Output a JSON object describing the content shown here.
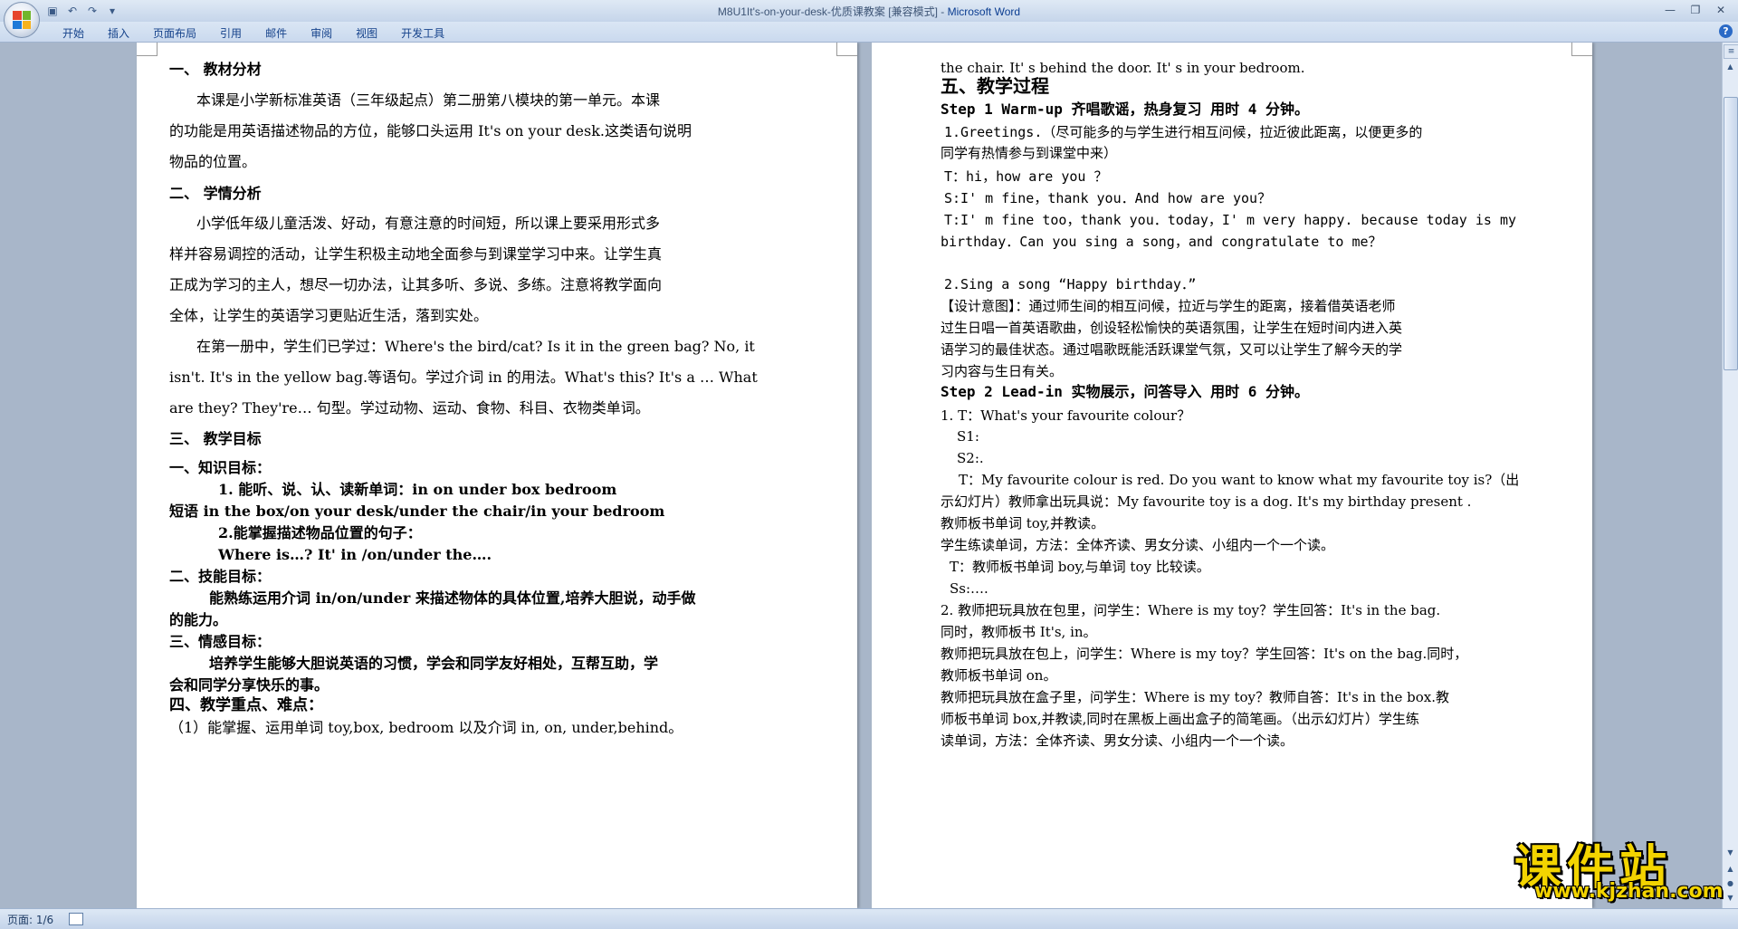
{
  "window": {
    "title_doc": "M8U1It's-on-your-desk-优质课教案 [兼容模式]",
    "title_sep": " - ",
    "title_app": "Microsoft Word"
  },
  "ribbon": {
    "tabs": [
      "开始",
      "插入",
      "页面布局",
      "引用",
      "邮件",
      "审阅",
      "视图",
      "开发工具"
    ]
  },
  "status": {
    "page": "页面: 1/6"
  },
  "watermark": {
    "text": "课件站",
    "url": "www.kjzhan.com"
  },
  "page1": {
    "lines": [
      "一、  教材分材",
      "本课是小学新标准英语（三年级起点）第二册第八模块的第一单元。本课",
      "的功能是用英语描述物品的方位，能够口头运用 It's on your desk.这类语句说明",
      "物品的位置。",
      "二、  学情分析",
      "小学低年级儿童活泼、好动，有意注意的时间短，所以课上要采用形式多",
      "样并容易调控的活动，让学生积极主动地全面参与到课堂学习中来。让学生真",
      "正成为学习的主人，想尽一切办法，让其多听、多说、多练。注意将教学面向",
      "全体，让学生的英语学习更贴近生活，落到实处。",
      "在第一册中，学生们已学过：Where's the bird/cat? Is it in the green bag? No, it",
      "isn't. It's in the yellow bag.等语句。学过介词 in 的用法。What's this? It's a … What",
      "are they? They're… 句型。学过动物、运动、食物、科目、衣物类单词。",
      "三、  教学目标",
      "一、知识目标：",
      "1.   能听、说、认、读新单词：in    on    under    box    bedroom",
      "短语 in the box/on your desk/under the chair/in your bedroom",
      "2.能掌握描述物品位置的句子：",
      "Where    is…?    It' in /on/under    the….",
      "二、技能目标：",
      "能熟练运用介词 in/on/under 来描述物体的具体位置,培养大胆说，动手做",
      "的能力。",
      "三、情感目标：",
      "培养学生能够大胆说英语的习惯，学会和同学友好相处，互帮互助，学",
      "会和同学分享快乐的事。",
      "四、教学重点、难点：",
      "（1）能掌握、运用单词 toy,box, bedroom 以及介词 in, on, under,behind。"
    ]
  },
  "page2": {
    "lines": [
      "the chair. It' s behind the door. It' s in your bedroom.",
      "五、教学过程",
      "Step 1 Warm-up 齐唱歌谣，热身复习    用时 4 分钟。",
      "1.Greetings.（尽可能多的与学生进行相互问候，拉近彼此距离，以便更多的",
      "同学有热情参与到课堂中来）",
      "T：hi，how are you  ？",
      "S:I' m  fine，thank you．And how are you？",
      "T:I' m fine too，thank you．today，I' m very happy. because today is my",
      "birthday．Can you sing a song，and congratulate  to me？",
      "",
      "2.Sing a song  “Happy birthday．”",
      "【设计意图】：通过师生间的相互问候，拉近与学生的距离，接着借英语老师",
      "过生日唱一首英语歌曲，创设轻松愉快的英语氛围，让学生在短时间内进入英",
      "语学习的最佳状态。通过唱歌既能活跃课堂气氛，又可以让学生了解今天的学",
      "习内容与生日有关。",
      "Step 2 Lead-in 实物展示，问答导入    用时 6 分钟。",
      "1.  T：What's your favourite colour？",
      "S1:",
      "S2:.",
      "T：My favourite colour is red. Do you want to know what my favourite toy is?（出",
      "示幻灯片）教师拿出玩具说：My favourite toy is a dog. It's my birthday present .",
      "教师板书单词 toy,并教读。",
      "学生练读单词，方法：全体齐读、男女分读、小组内一个一个读。",
      "T：教师板书单词 boy,与单词 toy 比较读。",
      "Ss:….",
      "2. 教师把玩具放在包里，问学生：Where is my toy？学生回答：It's in the bag.",
      "同时，教师板书 It's, in。",
      "教师把玩具放在包上，问学生：Where is my toy？学生回答：It's on the bag.同时，",
      "教师板书单词 on。",
      "教师把玩具放在盒子里，问学生：Where is my toy？教师自答：It's in the box.教",
      "师板书单词 box,并教读,同时在黑板上画出盒子的简笔画。（出示幻灯片）学生练",
      "读单词，方法：全体齐读、男女分读、小组内一个一个读。"
    ]
  }
}
